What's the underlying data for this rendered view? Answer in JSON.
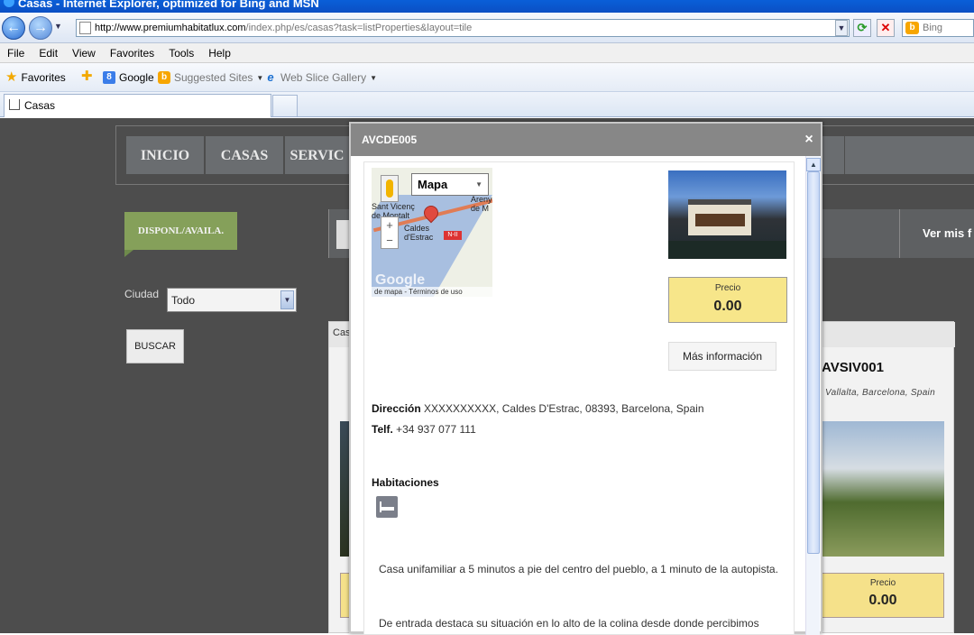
{
  "window": {
    "title": "Casas - Internet Explorer, optimized for Bing and MSN"
  },
  "address": {
    "url_host": "http://www.premiumhabitatlux.com",
    "url_path": "/index.php/es/casas?task=listProperties&layout=tile",
    "search_placeholder": "Bing"
  },
  "menu": [
    "File",
    "Edit",
    "View",
    "Favorites",
    "Tools",
    "Help"
  ],
  "favorites": {
    "favorites_label": "Favorites",
    "google_label": "Google",
    "suggested_label": "Suggested Sites",
    "webslice_label": "Web Slice Gallery"
  },
  "tab": {
    "label": "Casas"
  },
  "site": {
    "nav": [
      "INICIO",
      "CASAS",
      "SERVIC"
    ],
    "availability_label": "DISPONL/AVAILA.",
    "ciudad_label": "Ciudad",
    "ciudad_value": "Todo",
    "buscar_label": "BUSCAR",
    "ver_mis_label": "Ver mis f",
    "listing_header": "Cas",
    "card2": {
      "title": "AVSIV001",
      "location": "Vallalta, Barcelona, Spain",
      "price_label": "Precio",
      "price_value": "0.00"
    }
  },
  "modal": {
    "title": "AVCDE005",
    "close": "×",
    "map": {
      "type_label": "Mapa",
      "place_left": "Sant Vicenç de Montalt",
      "place_right": "Arenys de M",
      "place_center": "Caldes d'Estrac",
      "road": "N-II",
      "google": "Google",
      "terms": "de mapa - Términos de uso"
    },
    "price_label": "Precio",
    "price_value": "0.00",
    "more_info_label": "Más información",
    "address_label": "Dirección",
    "address_value": "XXXXXXXXXX, Caldes D'Estrac, 08393, Barcelona, Spain",
    "tel_label": "Telf.",
    "tel_value": "+34 937 077 111",
    "rooms_label": "Habitaciones",
    "description_1": "Casa unifamiliar a 5 minutos a pie del centro del pueblo, a 1 minuto de la autopista.",
    "description_2": "De entrada destaca su situación en lo alto de la colina desde donde percibimos"
  }
}
